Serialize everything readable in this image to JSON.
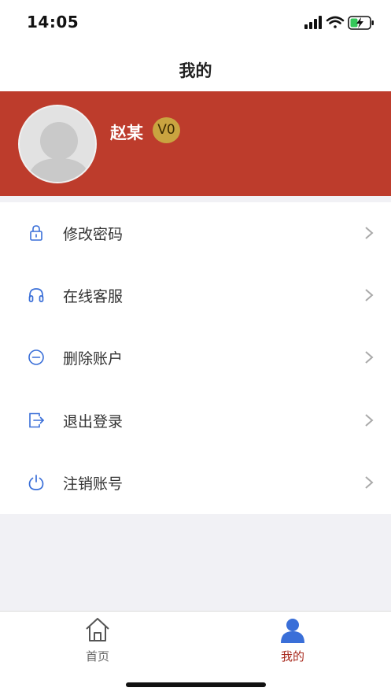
{
  "status_bar": {
    "time": "14:05"
  },
  "nav": {
    "title": "我的"
  },
  "profile": {
    "name": "赵某",
    "level_badge": "V0"
  },
  "menu": {
    "items": [
      {
        "label": "修改密码",
        "icon": "lock-icon"
      },
      {
        "label": "在线客服",
        "icon": "headset-icon"
      },
      {
        "label": "删除账户",
        "icon": "minus-circle-icon"
      },
      {
        "label": "退出登录",
        "icon": "logout-icon"
      },
      {
        "label": "注销账号",
        "icon": "power-icon"
      }
    ]
  },
  "tab_bar": {
    "items": [
      {
        "label": "首页",
        "icon": "home-icon",
        "active": false
      },
      {
        "label": "我的",
        "icon": "person-icon",
        "active": true
      }
    ]
  },
  "colors": {
    "brand_red": "#bd3c2c",
    "badge_gold": "#c9a440",
    "icon_blue": "#3a6fd8",
    "tab_active": "#a8281c",
    "tab_inactive": "#666666"
  }
}
